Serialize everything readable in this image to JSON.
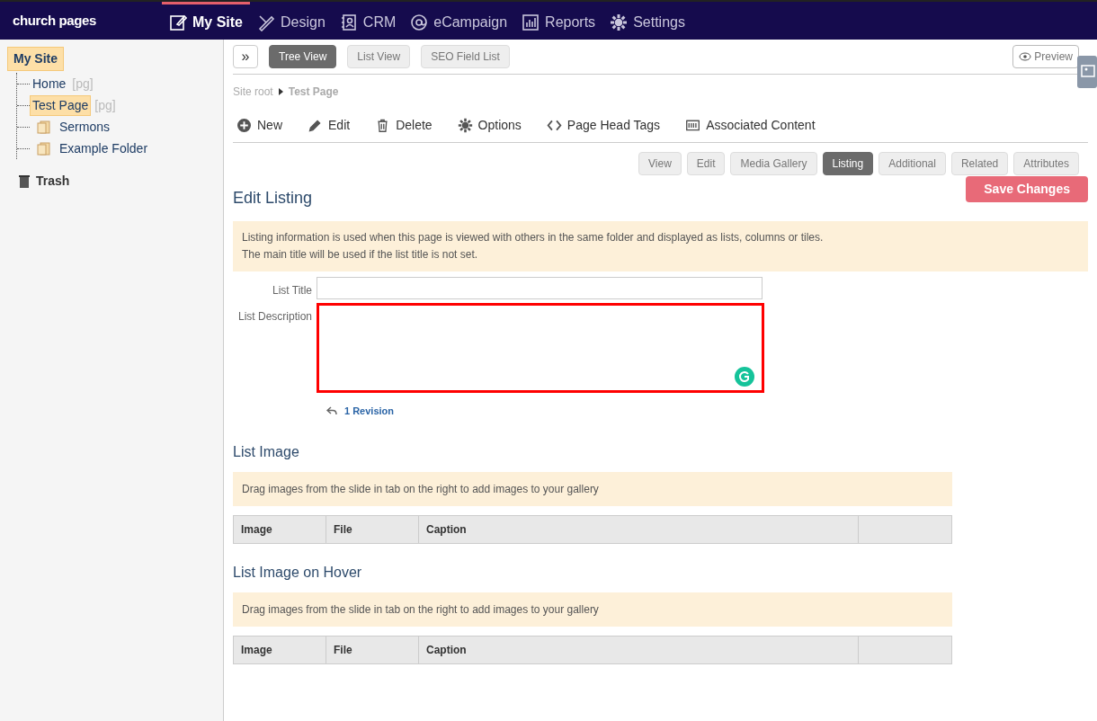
{
  "logo": "church pages",
  "nav": [
    {
      "label": "My Site",
      "selected": true
    },
    {
      "label": "Design",
      "selected": false
    },
    {
      "label": "CRM",
      "selected": false
    },
    {
      "label": "eCampaign",
      "selected": false
    },
    {
      "label": "Reports",
      "selected": false
    },
    {
      "label": "Settings",
      "selected": false
    }
  ],
  "tree": {
    "root": {
      "label": "My Site",
      "selected": true
    },
    "children": [
      {
        "label": "Home",
        "kind": "page",
        "suffix": "[pg]",
        "selected": false
      },
      {
        "label": "Test Page",
        "kind": "page",
        "suffix": "[pg]",
        "selected": true
      },
      {
        "label": "Sermons",
        "kind": "folder",
        "selected": false
      },
      {
        "label": "Example Folder",
        "kind": "folder",
        "selected": false
      }
    ],
    "trash": "Trash"
  },
  "expand_button": "»",
  "view_tabs": [
    {
      "label": "Tree View",
      "selected": true
    },
    {
      "label": "List View",
      "selected": false
    },
    {
      "label": "SEO Field List",
      "selected": false
    }
  ],
  "preview_button": "Preview",
  "breadcrumb": [
    "Site root",
    "Test Page"
  ],
  "actions": [
    "New",
    "Edit",
    "Delete",
    "Options",
    "Page Head Tags",
    "Associated Content"
  ],
  "section_tabs": [
    {
      "label": "View",
      "selected": false
    },
    {
      "label": "Edit",
      "selected": false
    },
    {
      "label": "Media Gallery",
      "selected": false
    },
    {
      "label": "Listing",
      "selected": true
    },
    {
      "label": "Additional",
      "selected": false
    },
    {
      "label": "Related",
      "selected": false
    },
    {
      "label": "Attributes",
      "selected": false
    }
  ],
  "heading": "Edit Listing",
  "save_button": "Save Changes",
  "info": [
    "Listing information is used when this page is viewed with others in the same folder and displayed as lists, columns or tiles.",
    "The main title will be used if the list title is not set."
  ],
  "fields": [
    {
      "label": "List Title",
      "kind": "text",
      "highlighted": false
    },
    {
      "label": "List Description",
      "kind": "textarea",
      "highlighted": true
    }
  ],
  "revision_link": "1 Revision",
  "image_sections": [
    {
      "title": "List Image",
      "note": "Drag images from the slide in tab on the right to add images to your gallery",
      "columns": [
        "Image",
        "File",
        "Caption"
      ]
    },
    {
      "title": "List Image on Hover",
      "note": "Drag images from the slide in tab on the right to add images to your gallery",
      "columns": [
        "Image",
        "File",
        "Caption"
      ]
    }
  ]
}
